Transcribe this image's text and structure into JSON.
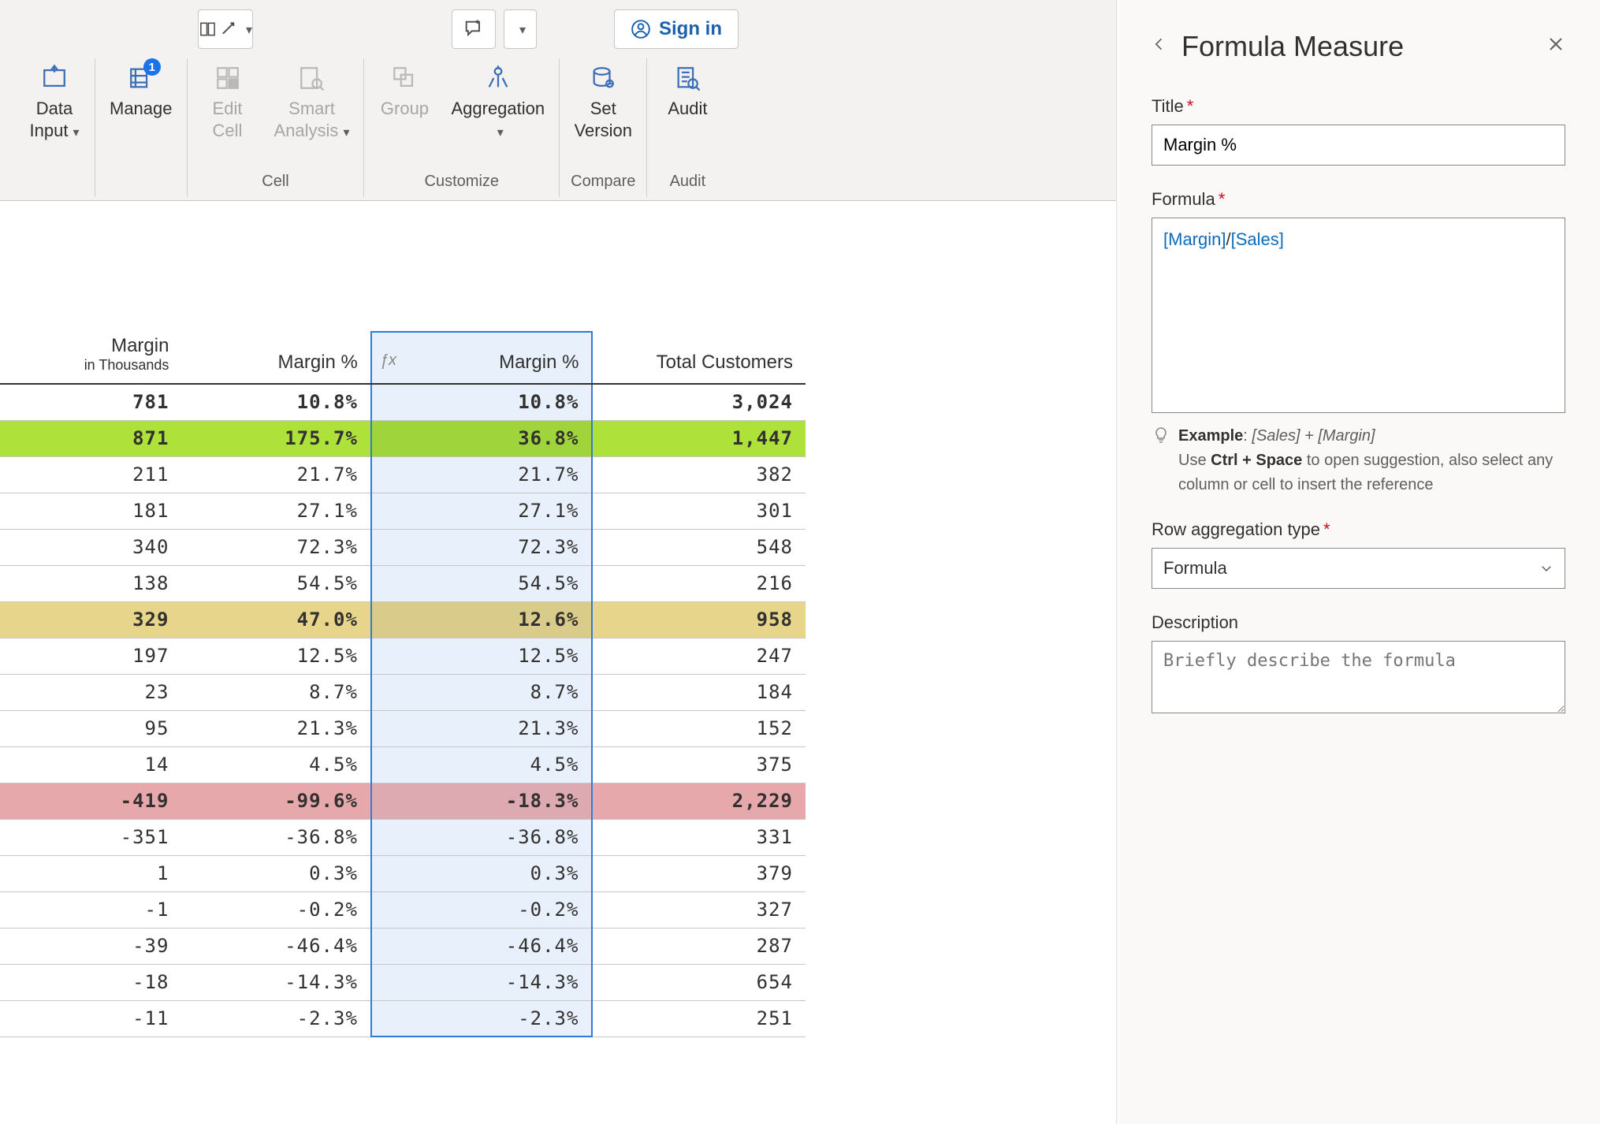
{
  "ribbon": {
    "sign_in": "Sign in",
    "buttons": {
      "data_input": "Data\nInput",
      "manage": "Manage",
      "edit_cell": "Edit\nCell",
      "smart_analysis": "Smart\nAnalysis",
      "group": "Group",
      "aggregation": "Aggregation",
      "set_version": "Set\nVersion",
      "audit": "Audit"
    },
    "groups": {
      "cell": "Cell",
      "customize": "Customize",
      "compare": "Compare",
      "audit": "Audit"
    },
    "manage_badge": "1"
  },
  "table": {
    "headers": {
      "margin": "Margin",
      "margin_sub": "in Thousands",
      "margin_pct": "Margin %",
      "margin_pct_fx": "Margin %",
      "fx_symbol": "ƒx",
      "total_customers": "Total Customers"
    },
    "rows": [
      {
        "cls": "bold",
        "margin": "781",
        "pct1": "10.8%",
        "pct2": "10.8%",
        "cust": "3,024"
      },
      {
        "cls": "bold green",
        "margin": "871",
        "pct1": "175.7%",
        "pct2": "36.8%",
        "cust": "1,447"
      },
      {
        "cls": "",
        "margin": "211",
        "pct1": "21.7%",
        "pct2": "21.7%",
        "cust": "382"
      },
      {
        "cls": "",
        "margin": "181",
        "pct1": "27.1%",
        "pct2": "27.1%",
        "cust": "301"
      },
      {
        "cls": "",
        "margin": "340",
        "pct1": "72.3%",
        "pct2": "72.3%",
        "cust": "548"
      },
      {
        "cls": "",
        "margin": "138",
        "pct1": "54.5%",
        "pct2": "54.5%",
        "cust": "216"
      },
      {
        "cls": "bold yellow",
        "margin": "329",
        "pct1": "47.0%",
        "pct2": "12.6%",
        "cust": "958"
      },
      {
        "cls": "",
        "margin": "197",
        "pct1": "12.5%",
        "pct2": "12.5%",
        "cust": "247"
      },
      {
        "cls": "",
        "margin": "23",
        "pct1": "8.7%",
        "pct2": "8.7%",
        "cust": "184"
      },
      {
        "cls": "",
        "margin": "95",
        "pct1": "21.3%",
        "pct2": "21.3%",
        "cust": "152"
      },
      {
        "cls": "",
        "margin": "14",
        "pct1": "4.5%",
        "pct2": "4.5%",
        "cust": "375"
      },
      {
        "cls": "bold red",
        "margin": "-419",
        "pct1": "-99.6%",
        "pct2": "-18.3%",
        "cust": "2,229"
      },
      {
        "cls": "",
        "margin": "-351",
        "pct1": "-36.8%",
        "pct2": "-36.8%",
        "cust": "331"
      },
      {
        "cls": "",
        "margin": "1",
        "pct1": "0.3%",
        "pct2": "0.3%",
        "cust": "379"
      },
      {
        "cls": "",
        "margin": "-1",
        "pct1": "-0.2%",
        "pct2": "-0.2%",
        "cust": "327"
      },
      {
        "cls": "",
        "margin": "-39",
        "pct1": "-46.4%",
        "pct2": "-46.4%",
        "cust": "287"
      },
      {
        "cls": "",
        "margin": "-18",
        "pct1": "-14.3%",
        "pct2": "-14.3%",
        "cust": "654"
      },
      {
        "cls": "",
        "margin": "-11",
        "pct1": "-2.3%",
        "pct2": "-2.3%",
        "cust": "251"
      }
    ]
  },
  "panel": {
    "heading": "Formula Measure",
    "title_label": "Title",
    "title_value": "Margin %",
    "formula_label": "Formula",
    "formula_ref1": "[Margin]",
    "formula_sep": "/",
    "formula_ref2": "[Sales]",
    "hint_example_label": "Example",
    "hint_example_value": "[Sales] + [Margin]",
    "hint_body_pre": "Use ",
    "hint_body_key": "Ctrl + Space",
    "hint_body_post": " to open suggestion, also select any column or cell to insert the reference",
    "row_agg_label": "Row aggregation type",
    "row_agg_value": "Formula",
    "desc_label": "Description",
    "desc_placeholder": "Briefly describe the formula"
  }
}
